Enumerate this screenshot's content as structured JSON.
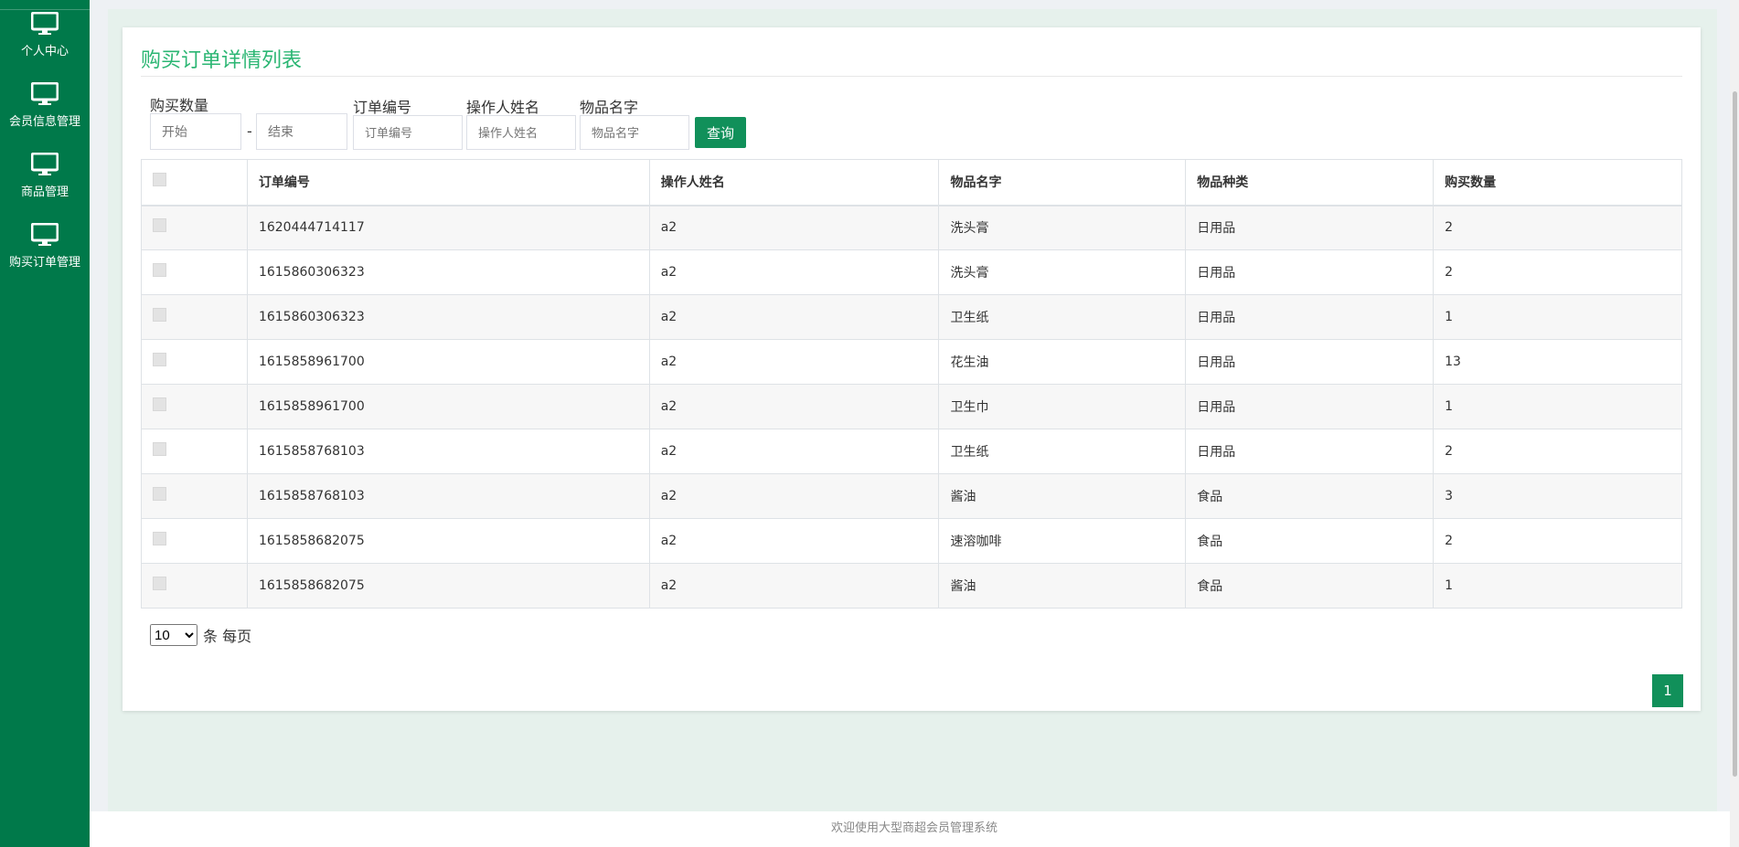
{
  "sidebar": {
    "items": [
      {
        "label": "个人中心",
        "icon": "monitor-icon"
      },
      {
        "label": "会员信息管理",
        "icon": "monitor-icon"
      },
      {
        "label": "商品管理",
        "icon": "monitor-icon"
      },
      {
        "label": "购买订单管理",
        "icon": "monitor-icon"
      }
    ]
  },
  "page": {
    "title": "购买订单详情列表",
    "footer": "欢迎使用大型商超会员管理系统"
  },
  "filters": {
    "qty_label": "购买数量",
    "qty_start_placeholder": "开始",
    "qty_end_placeholder": "结束",
    "dash": "-",
    "order_label": "订单编号",
    "order_placeholder": "订单编号",
    "operator_label": "操作人姓名",
    "operator_placeholder": "操作人姓名",
    "item_label": "物品名字",
    "item_placeholder": "物品名字",
    "query_button": "查询"
  },
  "table": {
    "columns": [
      "订单编号",
      "操作人姓名",
      "物品名字",
      "物品种类",
      "购买数量"
    ],
    "rows": [
      [
        "1620444714117",
        "a2",
        "洗头膏",
        "日用品",
        "2"
      ],
      [
        "1615860306323",
        "a2",
        "洗头膏",
        "日用品",
        "2"
      ],
      [
        "1615860306323",
        "a2",
        "卫生纸",
        "日用品",
        "1"
      ],
      [
        "1615858961700",
        "a2",
        "花生油",
        "日用品",
        "13"
      ],
      [
        "1615858961700",
        "a2",
        "卫生巾",
        "日用品",
        "1"
      ],
      [
        "1615858768103",
        "a2",
        "卫生纸",
        "日用品",
        "2"
      ],
      [
        "1615858768103",
        "a2",
        "酱油",
        "食品",
        "3"
      ],
      [
        "1615858682075",
        "a2",
        "速溶咖啡",
        "食品",
        "2"
      ],
      [
        "1615858682075",
        "a2",
        "酱油",
        "食品",
        "1"
      ]
    ]
  },
  "pagination": {
    "page_size": "10",
    "page_size_options": [
      "10"
    ],
    "per_page_text": "条 每页",
    "current_page": "1"
  },
  "colors": {
    "sidebar": "#00794a",
    "accent": "#11905a",
    "title": "#2bb673"
  }
}
